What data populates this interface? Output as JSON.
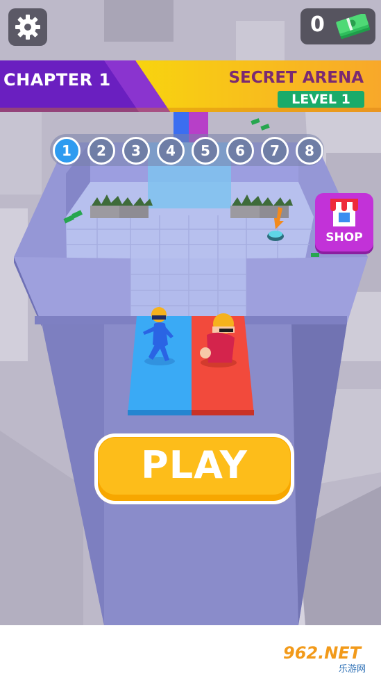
{
  "hud": {
    "money_count": "0",
    "settings_icon": "gear-icon",
    "cash_icon": "cash-stack-icon"
  },
  "banner": {
    "chapter": "CHAPTER 1",
    "arena": "SECRET ARENA",
    "level": "LEVEL 1"
  },
  "progress": {
    "stages": [
      "1",
      "2",
      "3",
      "4",
      "5",
      "6",
      "7",
      "8"
    ],
    "current_stage": 1
  },
  "shop": {
    "label": "SHOP",
    "icon": "storefront-icon"
  },
  "play": {
    "label": "PLAY"
  },
  "watermark": {
    "text": "962.NET",
    "sub": "乐游网"
  },
  "colors": {
    "banner_purple": "#6a1fc0",
    "banner_yellow": "#f5e400",
    "blue_pad": "#3aaaf5",
    "red_pad": "#f24a3c",
    "play": "#fdbd1a",
    "shop": "#c232d8"
  }
}
